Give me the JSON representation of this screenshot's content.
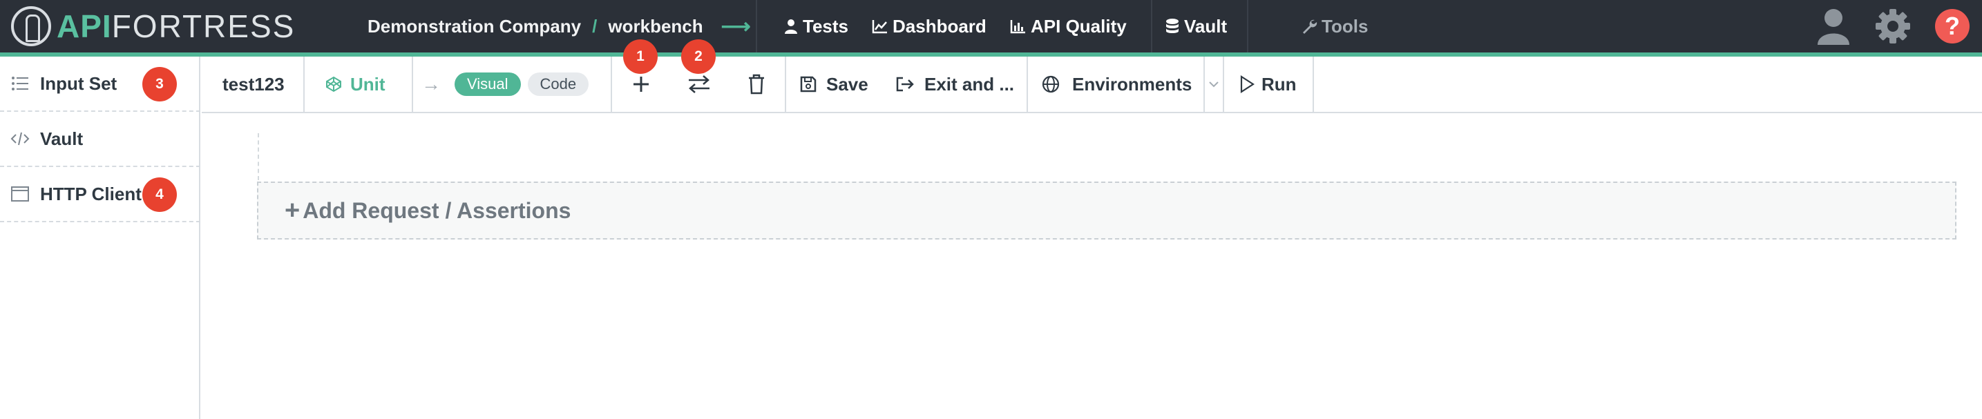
{
  "brand": {
    "part1": "API",
    "part2": "FORTRESS"
  },
  "breadcrumb": {
    "company": "Demonstration Company",
    "separator": "/",
    "project": "workbench",
    "arrow": "⟶"
  },
  "nav": {
    "tests": "Tests",
    "dashboard": "Dashboard",
    "api_quality": "API Quality",
    "vault": "Vault",
    "tools": "Tools"
  },
  "help": {
    "glyph": "?"
  },
  "sidebar": {
    "items": [
      {
        "label": "Input Set",
        "icon": "list-icon",
        "badge": "3"
      },
      {
        "label": "Vault",
        "icon": "code-icon",
        "badge": ""
      },
      {
        "label": "HTTP Client",
        "icon": "window-icon",
        "badge": "4"
      }
    ]
  },
  "toolbar": {
    "test_name": "test123",
    "unit_label": "Unit",
    "visual_label": "Visual",
    "code_label": "Code",
    "save_label": "Save",
    "exit_label": "Exit and ...",
    "environments_label": "Environments",
    "run_label": "Run",
    "badges": {
      "add": "1",
      "swap": "2"
    }
  },
  "canvas": {
    "add_request_label": "Add Request / Assertions",
    "add_glyph": "+"
  },
  "colors": {
    "topbar": "#2b3038",
    "accent": "#50b696",
    "badge": "#e8422f",
    "help": "#f05b55"
  }
}
